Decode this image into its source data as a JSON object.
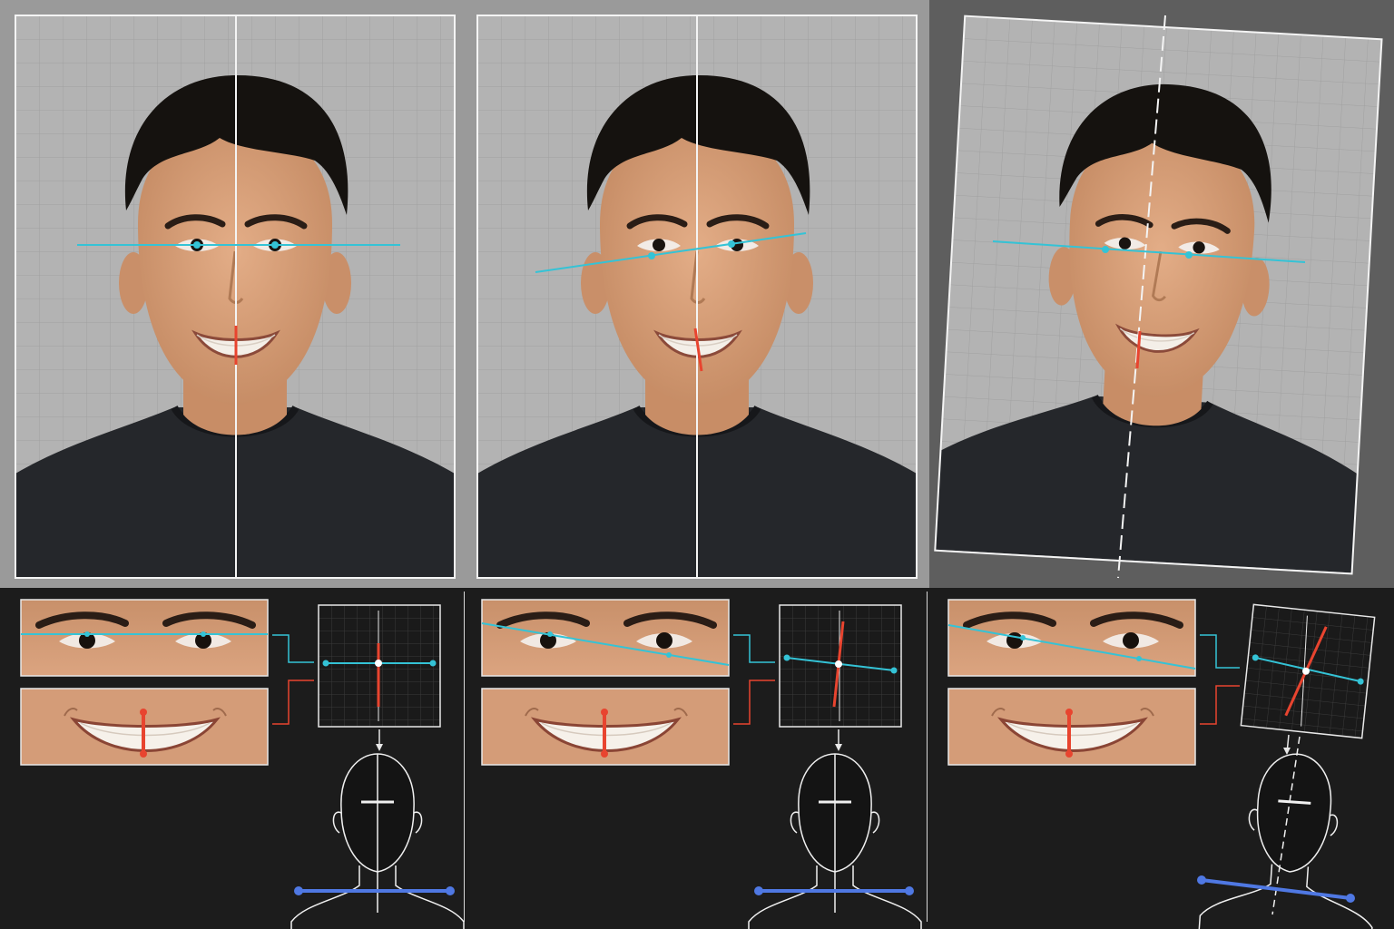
{
  "colors": {
    "eye_line": "#34c3d6",
    "tooth_line": "#e8442f",
    "shoulder_line": "#4f78e3",
    "axis": "#ffffff",
    "grid_bg": "#b5b5b5",
    "grid_line": "#a4a4a4",
    "hair": "#15120f",
    "skin": "#d8a17b",
    "shirt": "#24262a",
    "dark_bg": "#1c1c1c"
  },
  "panels": [
    {
      "id": "panel-1",
      "description_icon": "portrait-photo-icon",
      "state": "aligned"
    },
    {
      "id": "panel-2",
      "description_icon": "portrait-photo-icon",
      "state": "tilted-features"
    },
    {
      "id": "panel-3",
      "description_icon": "portrait-photo-icon",
      "state": "rotated-frame"
    }
  ],
  "icons": {
    "eye_strip": "eye-crop-icon",
    "mouth_strip": "smile-crop-icon",
    "axis_box": "alignment-crosshair-icon",
    "head_outline": "head-shoulders-outline-icon",
    "connector": "arrow-connector-icon"
  }
}
